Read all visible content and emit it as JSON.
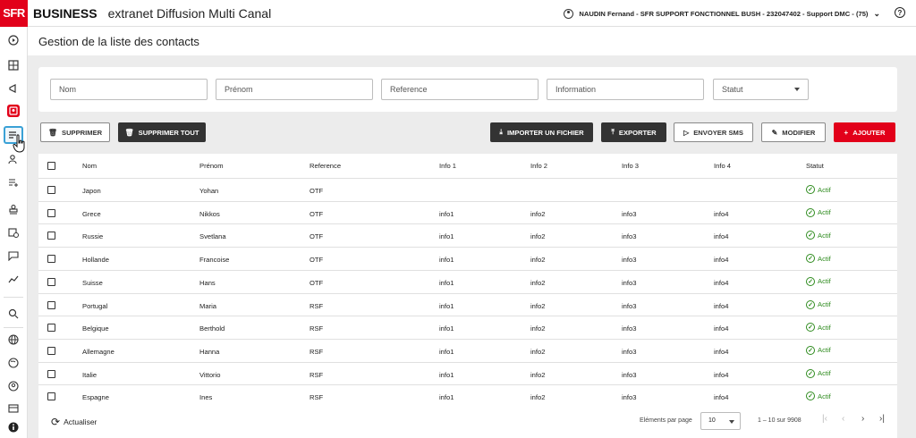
{
  "app": {
    "logo": "SFR",
    "brand": "BUSINESS",
    "title": "extranet Diffusion Multi Canal",
    "user": "NAUDIN Fernand - SFR SUPPORT FONCTIONNEL BUSH - 232047402 - Support DMC - (75)"
  },
  "page": {
    "title": "Gestion de la liste des contacts"
  },
  "filters": {
    "nom": "Nom",
    "prenom": "Prénom",
    "reference": "Reference",
    "information": "Information",
    "statut": "Statut"
  },
  "actions": {
    "supprimer": "SUPPRIMER",
    "supprimer_tout": "SUPPRIMER TOUT",
    "importer": "IMPORTER UN FICHIER",
    "exporter": "EXPORTER",
    "envoyer_sms": "ENVOYER SMS",
    "modifier": "MODIFIER",
    "ajouter": "AJOUTER"
  },
  "table": {
    "headers": [
      "Nom",
      "Prénom",
      "Reference",
      "Info 1",
      "Info 2",
      "Info 3",
      "Info 4",
      "Statut"
    ],
    "rows": [
      {
        "nom": "Japon",
        "prenom": "Yohan",
        "ref": "OTF",
        "i1": "",
        "i2": "",
        "i3": "",
        "i4": "",
        "statut": "Actif"
      },
      {
        "nom": "Grece",
        "prenom": "Nikkos",
        "ref": "OTF",
        "i1": "info1",
        "i2": "info2",
        "i3": "info3",
        "i4": "info4",
        "statut": "Actif"
      },
      {
        "nom": "Russie",
        "prenom": "Svetlana",
        "ref": "OTF",
        "i1": "info1",
        "i2": "info2",
        "i3": "info3",
        "i4": "info4",
        "statut": "Actif"
      },
      {
        "nom": "Hollande",
        "prenom": "Francoise",
        "ref": "OTF",
        "i1": "info1",
        "i2": "info2",
        "i3": "info3",
        "i4": "info4",
        "statut": "Actif"
      },
      {
        "nom": "Suisse",
        "prenom": "Hans",
        "ref": "OTF",
        "i1": "info1",
        "i2": "info2",
        "i3": "info3",
        "i4": "info4",
        "statut": "Actif"
      },
      {
        "nom": "Portugal",
        "prenom": "Maria",
        "ref": "RSF",
        "i1": "info1",
        "i2": "info2",
        "i3": "info3",
        "i4": "info4",
        "statut": "Actif"
      },
      {
        "nom": "Belgique",
        "prenom": "Berthold",
        "ref": "RSF",
        "i1": "info1",
        "i2": "info2",
        "i3": "info3",
        "i4": "info4",
        "statut": "Actif"
      },
      {
        "nom": "Allemagne",
        "prenom": "Hanna",
        "ref": "RSF",
        "i1": "info1",
        "i2": "info2",
        "i3": "info3",
        "i4": "info4",
        "statut": "Actif"
      },
      {
        "nom": "Italie",
        "prenom": "Vittorio",
        "ref": "RSF",
        "i1": "info1",
        "i2": "info2",
        "i3": "info3",
        "i4": "info4",
        "statut": "Actif"
      },
      {
        "nom": "Espagne",
        "prenom": "Ines",
        "ref": "RSF",
        "i1": "info1",
        "i2": "info2",
        "i3": "info3",
        "i4": "info4",
        "statut": "Actif"
      }
    ]
  },
  "footer": {
    "refresh": "Actualiser",
    "per_page_label": "Eléments par page",
    "per_page_value": "10",
    "range": "1 – 10 sur 9908"
  },
  "colors": {
    "brand_red": "#e2001a",
    "active_green": "#2e8b1e",
    "dark_button": "#333333"
  }
}
